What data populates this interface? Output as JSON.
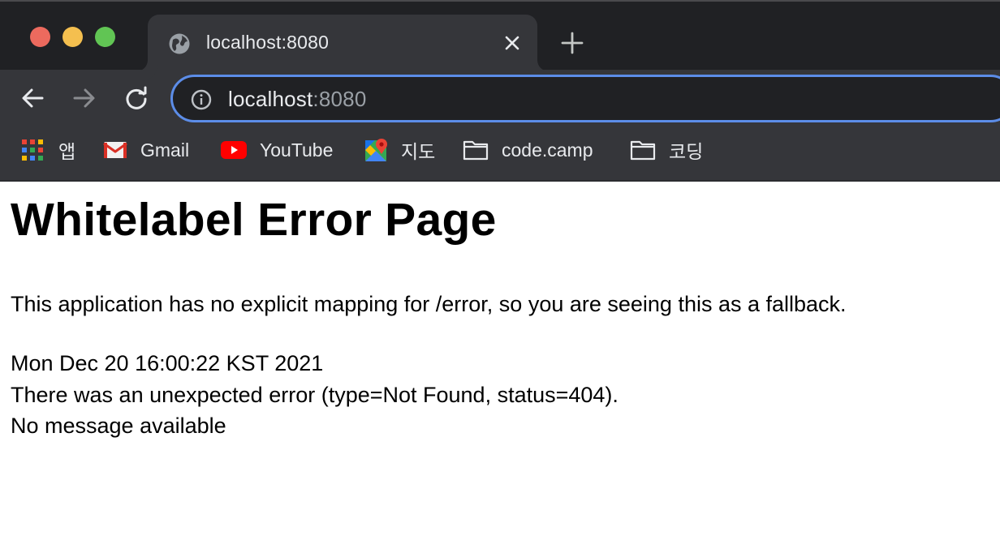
{
  "tab": {
    "title": "localhost:8080",
    "favicon": "globe-icon"
  },
  "toolbar": {
    "url_host": "localhost",
    "url_port": ":8080"
  },
  "bookmarks": [
    {
      "label": "앱",
      "icon": "apps-grid-icon"
    },
    {
      "label": "Gmail",
      "icon": "gmail-icon"
    },
    {
      "label": "YouTube",
      "icon": "youtube-icon"
    },
    {
      "label": "지도",
      "icon": "maps-icon"
    },
    {
      "label": "code.camp",
      "icon": "folder-icon"
    },
    {
      "label": "코딩",
      "icon": "folder-icon"
    }
  ],
  "page": {
    "title": "Whitelabel Error Page",
    "description": "This application has no explicit mapping for /error, so you are seeing this as a fallback.",
    "timestamp": "Mon Dec 20 16:00:22 KST 2021",
    "error_line": "There was an unexpected error (type=Not Found, status=404).",
    "message": "No message available"
  },
  "colors": {
    "chrome_dark": "#202124",
    "chrome_toolbar": "#35363a",
    "omnibox_focus": "#5c8de8",
    "traffic_close": "#ec6a5e",
    "traffic_minimize": "#f4bf4f",
    "traffic_maximize": "#61c554"
  }
}
